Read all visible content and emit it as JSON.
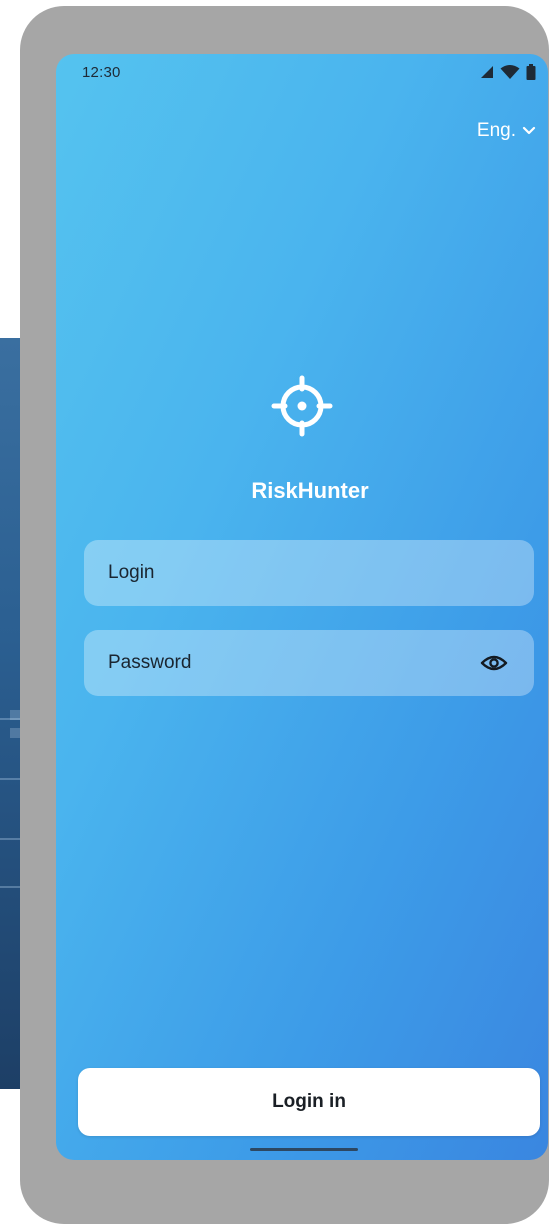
{
  "status_bar": {
    "time": "12:30",
    "icons": [
      "signal-icon",
      "wifi-icon",
      "battery-icon"
    ]
  },
  "language": {
    "label": "Eng.",
    "icon": "chevron-down-icon"
  },
  "brand": {
    "logo_icon": "crosshair-icon",
    "app_name": "RiskHunter"
  },
  "form": {
    "login_placeholder": "Login",
    "login_value": "",
    "password_placeholder": "Password",
    "password_value": "",
    "password_toggle_icon": "eye-icon"
  },
  "actions": {
    "login_button_label": "Login in"
  },
  "colors": {
    "gradient_start": "#55c3ef",
    "gradient_end": "#3a86e0",
    "frame": "#a6a6a6",
    "button_bg": "#ffffff"
  }
}
